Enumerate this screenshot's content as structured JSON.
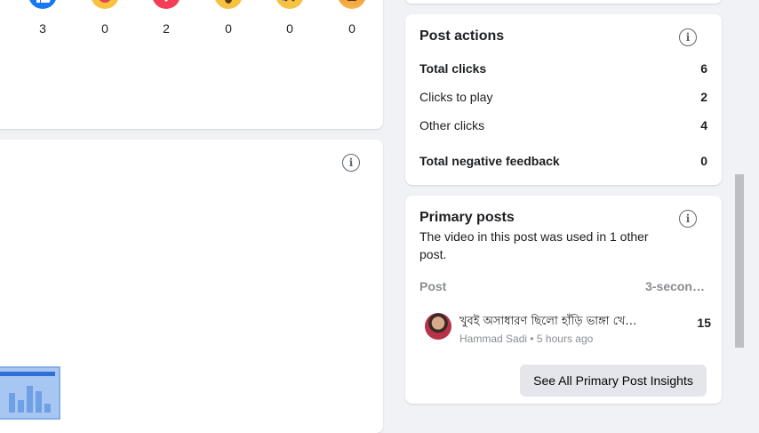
{
  "reactions": [
    {
      "type": "like",
      "icon": "like-emoji-icon",
      "count": "3"
    },
    {
      "type": "haha",
      "icon": "haha-emoji-icon",
      "count": "0"
    },
    {
      "type": "love",
      "icon": "love-emoji-icon",
      "count": "2"
    },
    {
      "type": "wow",
      "icon": "wow-emoji-icon",
      "count": "0"
    },
    {
      "type": "sad",
      "icon": "sad-emoji-icon",
      "count": "0"
    },
    {
      "type": "angry",
      "icon": "angry-emoji-icon",
      "count": "0"
    }
  ],
  "info_icon_glyph": "i",
  "post_actions": {
    "title": "Post actions",
    "rows": [
      {
        "label": "Total clicks",
        "value": "6"
      },
      {
        "label": "Clicks to play",
        "value": "2"
      },
      {
        "label": "Other clicks",
        "value": "4"
      },
      {
        "label": "Total negative feedback",
        "value": "0"
      }
    ]
  },
  "primary_posts": {
    "title": "Primary posts",
    "description": "The video in this post was used in 1 other post.",
    "col_post": "Post",
    "col_metric": "3-secon…",
    "post": {
      "title": "খুবই অসাধারণ ছিলো হাঁড়ি ভাঙ্গা খেলা …",
      "author": "Hammad Sadi",
      "separator": "•",
      "time": "5 hours ago",
      "value": "15"
    },
    "button_label": "See All Primary Post Insights"
  },
  "colors": {
    "background": "#f0f2f5",
    "card": "#ffffff",
    "like_blue": "#1877f2",
    "love_red": "#f33e58",
    "emoji_yellow": "#f7c142",
    "muted_text": "#8a8d91",
    "button_gray": "#e4e6eb"
  }
}
